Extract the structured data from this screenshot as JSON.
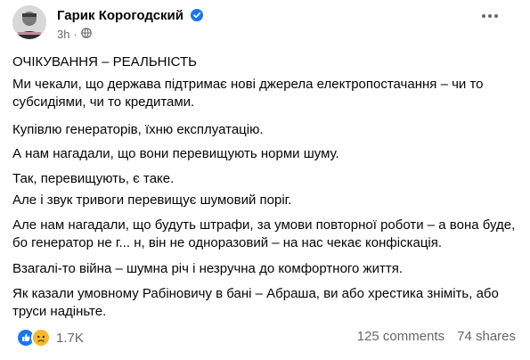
{
  "post": {
    "author": "Гарик Корогодский",
    "time": "3h",
    "separator": "·",
    "paragraphs": [
      "ОЧІКУВАННЯ – РЕАЛЬНІСТЬ",
      "Ми чекали, що держава підтримає нові джерела електропостачання – чи то субсидіями, чи то кредитами.",
      "Купівлю генераторів, їхню експлуатацію.",
      "А нам нагадали, що вони перевищують норми шуму.",
      "Так, перевищують, є таке.",
      "Але і звук тривоги перевищує шумовий поріг.",
      "Але нам нагадали, що будуть штрафи, за умови повторної роботи – а вона буде, бо генератор не г... н, він не одноразовий – на нас чекає конфіскація.",
      "Взагалі-то війна – шумна річ і незручна до комфортного життя.",
      "Як казали умовному Рабіновичу в бані – Абраша, ви або хрестика зніміть, або труси надіньте."
    ]
  },
  "footer": {
    "reaction_count": "1.7K",
    "comments": "125 comments",
    "shares": "74 shares"
  },
  "icons": {
    "verified": "verified-badge-icon",
    "globe": "globe-icon",
    "menu": "more-options-icon",
    "like": "like-reaction-icon",
    "sad": "sad-reaction-icon"
  },
  "colors": {
    "accent_blue": "#1877f2",
    "secondary_text": "#65676b",
    "sad_yellow": "#f7b928"
  }
}
